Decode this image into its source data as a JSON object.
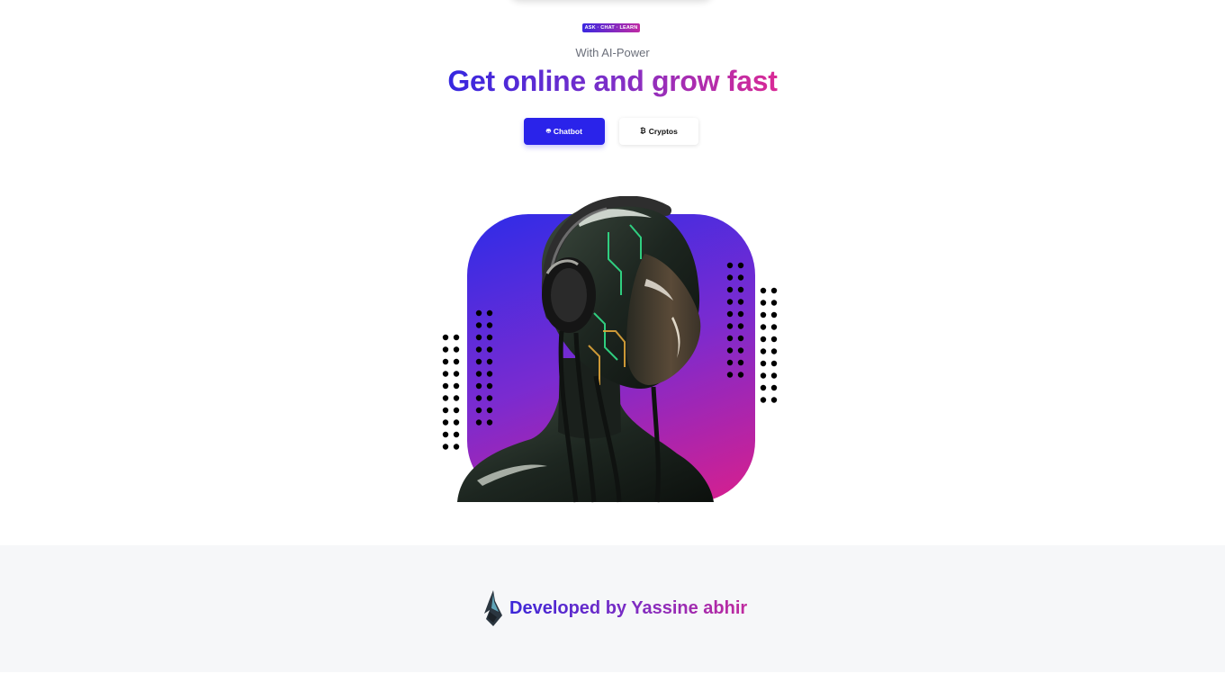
{
  "hero": {
    "badge": "ASK · CHAT · LEARN",
    "subtitle": "With AI-Power",
    "headline": "Get online and grow fast",
    "buttons": {
      "chatbot": {
        "icon": "robot-icon",
        "label": "Chatbot"
      },
      "cryptos": {
        "icon": "bitcoin-icon",
        "label": "Cryptos"
      }
    },
    "image": {
      "subject": "ai-headphones-figure"
    }
  },
  "footer": {
    "logo": "ya-logo-icon",
    "text": "Developed by Yassine abhir"
  },
  "colors": {
    "primary": "#2a23ea",
    "gradient_start": "#2e2ce8",
    "gradient_mid": "#7a2bd0",
    "gradient_end": "#d91f8c",
    "footer_bg": "#f6f7f9"
  }
}
